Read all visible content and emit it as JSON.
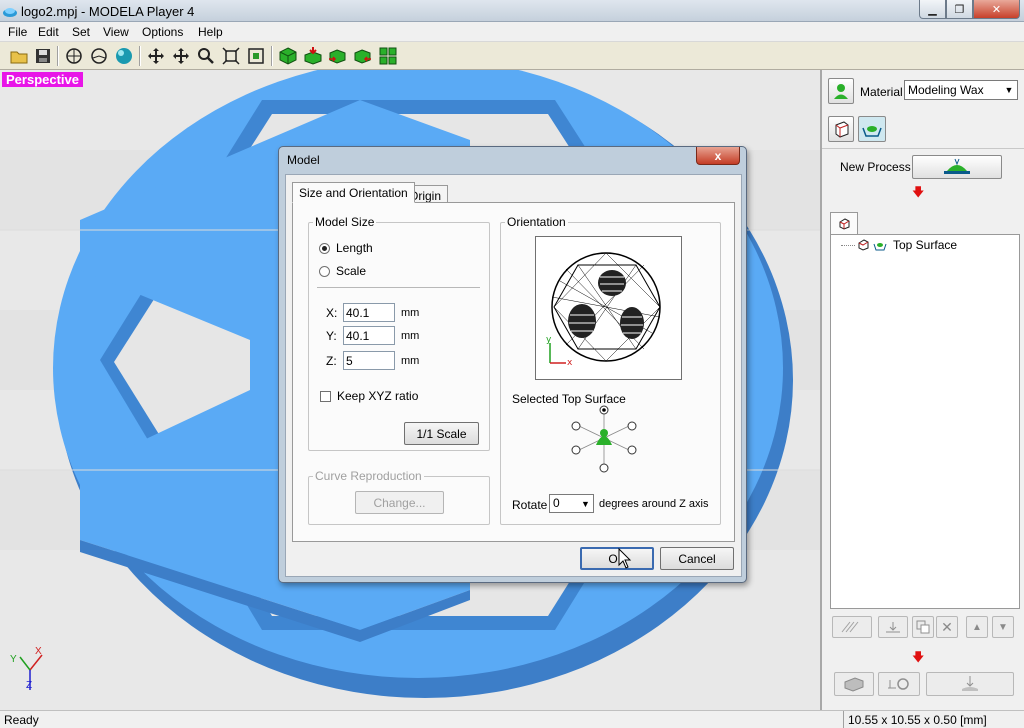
{
  "window": {
    "title": "logo2.mpj - MODELA Player 4"
  },
  "menu": [
    "File",
    "Edit",
    "Set",
    "View",
    "Options",
    "Help"
  ],
  "viewport": {
    "view_label": "Perspective",
    "model_color": "#5aaaf5",
    "axis": {
      "x": "X",
      "y": "Y",
      "z": "Z"
    }
  },
  "panel": {
    "material_label": "Material",
    "material_value": "Modeling Wax",
    "new_process_label": "New Process",
    "tree": {
      "item": "Top Surface"
    }
  },
  "status": {
    "left": "Ready",
    "dimensions": "10.55 x 10.55 x 0.50 [mm]"
  },
  "dialog": {
    "title": "Model",
    "close": "x",
    "tabs": [
      "Size and Orientation",
      "Origin"
    ],
    "model_size": {
      "label": "Model Size",
      "length": "Length",
      "scale": "Scale",
      "x_label": "X:",
      "x_value": "40.1",
      "y_label": "Y:",
      "y_value": "40.1",
      "z_label": "Z:",
      "z_value": "5",
      "unit": "mm",
      "keep_ratio": "Keep XYZ ratio",
      "scale_button": "1/1 Scale"
    },
    "curve": {
      "label": "Curve Reproduction",
      "change_button": "Change..."
    },
    "orientation": {
      "label": "Orientation",
      "selected_top_surface": "Selected Top Surface",
      "rotate_label": "Rotate",
      "rotate_value": "0",
      "rotate_suffix": "degrees around Z axis"
    },
    "ok": "OK",
    "cancel": "Cancel"
  }
}
